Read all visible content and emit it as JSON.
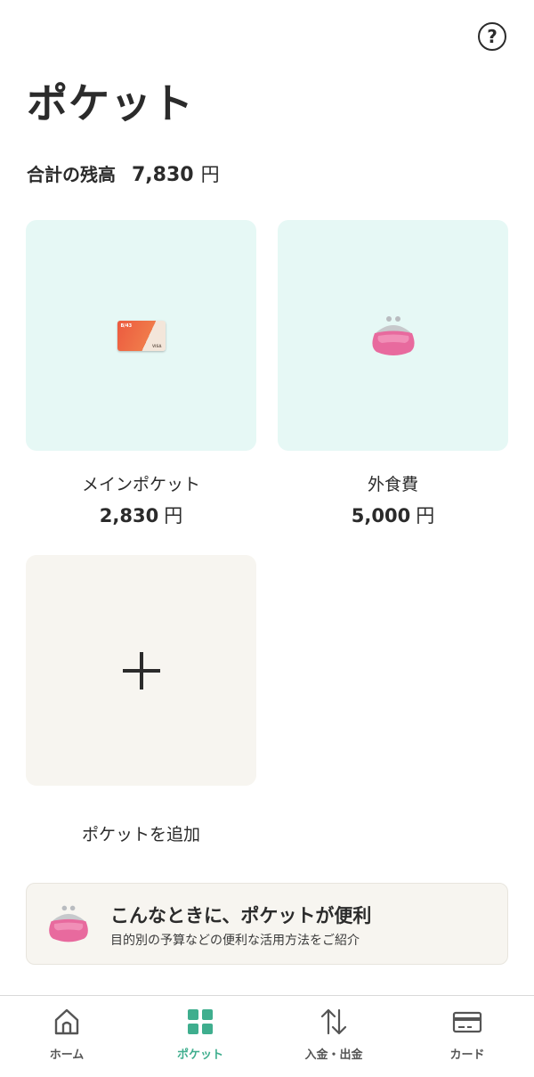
{
  "header": {
    "help_icon_glyph": "?",
    "title": "ポケット"
  },
  "balance": {
    "label": "合計の残高",
    "amount": "7,830",
    "unit": "円"
  },
  "pockets": [
    {
      "name": "メインポケット",
      "amount": "2,830",
      "unit": "円",
      "icon": "card-icon",
      "card_brand": "B/43",
      "card_network": "VISA"
    },
    {
      "name": "外食費",
      "amount": "5,000",
      "unit": "円",
      "icon": "purse-icon"
    }
  ],
  "add_pocket": {
    "label": "ポケットを追加",
    "icon": "plus-icon"
  },
  "promo": {
    "title": "こんなときに、ポケットが便利",
    "subtitle": "目的別の予算などの便利な活用方法をご紹介",
    "icon": "purse-icon"
  },
  "tabs": [
    {
      "label": "ホーム",
      "icon": "home-icon",
      "active": false
    },
    {
      "label": "ポケット",
      "icon": "grid-icon",
      "active": true
    },
    {
      "label": "入金・出金",
      "icon": "transfer-arrows-icon",
      "active": false
    },
    {
      "label": "カード",
      "icon": "credit-card-icon",
      "active": false
    }
  ],
  "colors": {
    "accent": "#3fae8e",
    "pocket_tile_bg": "#e6f8f5",
    "add_tile_bg": "#f7f5f0",
    "text": "#2b2b2b"
  }
}
